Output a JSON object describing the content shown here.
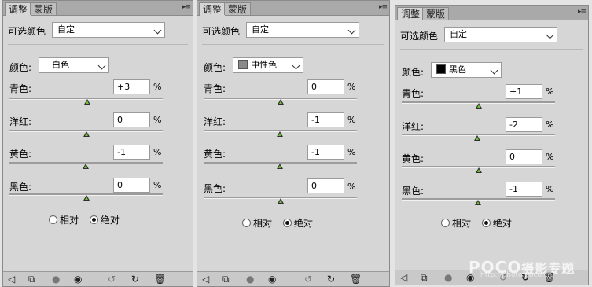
{
  "panels": [
    {
      "tabs": [
        "调整",
        "蒙版"
      ],
      "title": "可选颜色",
      "preset": "自定",
      "color_label": "颜色:",
      "color": {
        "name": "白色",
        "swatch": ""
      },
      "rows": [
        {
          "label": "青色:",
          "value": "+3",
          "unit": "%"
        },
        {
          "label": "洋红:",
          "value": "0",
          "unit": "%"
        },
        {
          "label": "黄色:",
          "value": "-1",
          "unit": "%"
        },
        {
          "label": "黑色:",
          "value": "0",
          "unit": "%"
        }
      ],
      "method": {
        "relative": "相对",
        "absolute": "绝对",
        "selected": "absolute"
      }
    },
    {
      "tabs": [
        "调整",
        "蒙版"
      ],
      "title": "可选颜色",
      "preset": "自定",
      "color_label": "颜色:",
      "color": {
        "name": "中性色",
        "swatch": "#8a8a8a"
      },
      "rows": [
        {
          "label": "青色:",
          "value": "0",
          "unit": "%"
        },
        {
          "label": "洋红:",
          "value": "-1",
          "unit": "%"
        },
        {
          "label": "黄色:",
          "value": "-1",
          "unit": "%"
        },
        {
          "label": "黑色:",
          "value": "0",
          "unit": "%"
        }
      ],
      "method": {
        "relative": "相对",
        "absolute": "绝对",
        "selected": "absolute"
      }
    },
    {
      "tabs": [
        "调整",
        "蒙版"
      ],
      "title": "可选颜色",
      "preset": "自定",
      "color_label": "颜色:",
      "color": {
        "name": "黑色",
        "swatch": "#000000"
      },
      "rows": [
        {
          "label": "青色:",
          "value": "+1",
          "unit": "%"
        },
        {
          "label": "洋红:",
          "value": "-2",
          "unit": "%"
        },
        {
          "label": "黄色:",
          "value": "0",
          "unit": "%"
        },
        {
          "label": "黑色:",
          "value": "-1",
          "unit": "%"
        }
      ],
      "method": {
        "relative": "相对",
        "absolute": "绝对",
        "selected": "absolute"
      }
    }
  ],
  "footer_icons": [
    "back-arrow-icon",
    "fit-layer-icon",
    "clip-icon",
    "eye-icon",
    "previous-state-icon",
    "reset-icon",
    "trash-icon"
  ],
  "watermark": {
    "brand": "POCO",
    "sub": "摄影专题",
    "url": "http://photo.poco.cn/"
  }
}
